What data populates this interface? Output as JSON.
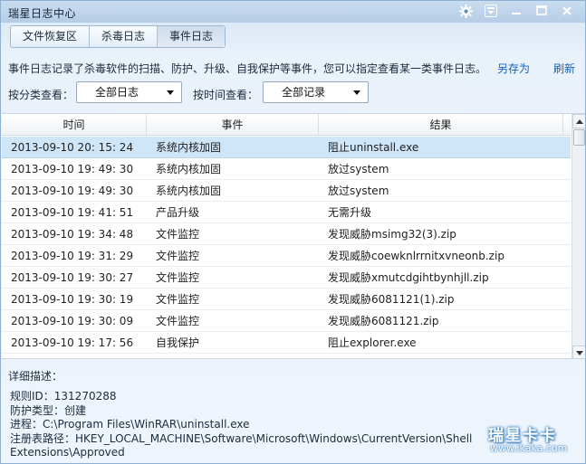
{
  "window": {
    "title": "瑞星日志中心"
  },
  "tabs": [
    {
      "label": "文件恢复区",
      "active": false
    },
    {
      "label": "杀毒日志",
      "active": false
    },
    {
      "label": "事件日志",
      "active": true
    }
  ],
  "info": {
    "description": "事件日志记录了杀毒软件的扫描、防护、升级、自我保护等事件，您可以指定查看某一类事件日志。",
    "save_as": "另存为",
    "refresh": "刷新"
  },
  "filters": {
    "category_label": "按分类查看：",
    "category_value": "全部日志",
    "time_label": "按时间查看：",
    "time_value": "全部记录"
  },
  "table": {
    "columns": [
      "时间",
      "事件",
      "结果"
    ],
    "rows": [
      {
        "time": "2013-09-10 20: 15: 24",
        "event": "系统内核加固",
        "result": "阻止uninstall.exe",
        "selected": true
      },
      {
        "time": "2013-09-10 19: 49: 30",
        "event": "系统内核加固",
        "result": "放过system",
        "selected": false
      },
      {
        "time": "2013-09-10 19: 49: 30",
        "event": "系统内核加固",
        "result": "放过system",
        "selected": false
      },
      {
        "time": "2013-09-10 19: 41: 51",
        "event": "产品升级",
        "result": "无需升级",
        "selected": false
      },
      {
        "time": "2013-09-10 19: 34: 48",
        "event": "文件监控",
        "result": "发现威胁msimg32(3).zip",
        "selected": false
      },
      {
        "time": "2013-09-10 19: 31: 29",
        "event": "文件监控",
        "result": "发现威胁coewknlrrnitxvneonb.zip",
        "selected": false
      },
      {
        "time": "2013-09-10 19: 30: 27",
        "event": "文件监控",
        "result": "发现威胁xmutcdgihtbynhjll.zip",
        "selected": false
      },
      {
        "time": "2013-09-10 19: 30: 19",
        "event": "文件监控",
        "result": "发现威胁6081121(1).zip",
        "selected": false
      },
      {
        "time": "2013-09-10 19: 30: 09",
        "event": "文件监控",
        "result": "发现威胁6081121.zip",
        "selected": false
      },
      {
        "time": "2013-09-10 19: 17: 56",
        "event": "自我保护",
        "result": "阻止explorer.exe",
        "selected": false
      }
    ]
  },
  "detail": {
    "title": "详细描述：",
    "lines": [
      "规则ID：131270288",
      "防护类型：创建",
      "进程：C:\\Program Files\\WinRAR\\uninstall.exe",
      "注册表路径：HKEY_LOCAL_MACHINE\\Software\\Microsoft\\Windows\\CurrentVersion\\Shell",
      "Extensions\\Approved"
    ]
  },
  "watermark": {
    "logo": "瑞星卡卡",
    "url": "www.ikaka.com"
  },
  "icons": {
    "settings": "gear-icon",
    "menu": "dropdown-menu-icon",
    "minimize": "minimize-icon",
    "maximize": "maximize-icon",
    "close": "close-icon"
  }
}
